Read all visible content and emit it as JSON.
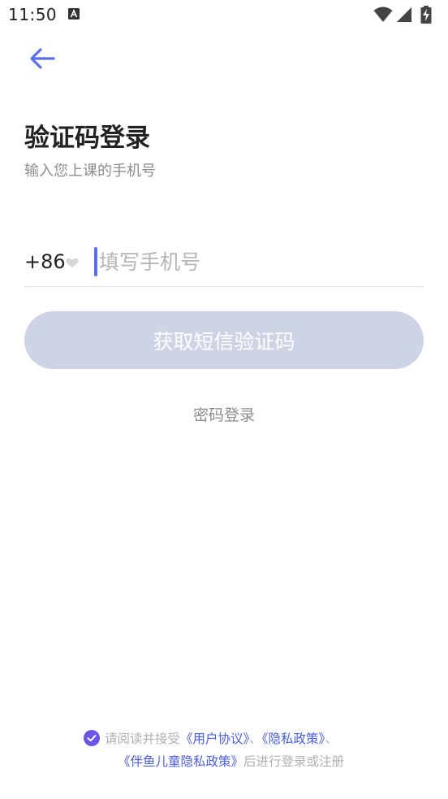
{
  "status_bar": {
    "time": "11:50",
    "notification_icon": "a-box-icon",
    "icons": [
      "wifi-icon",
      "signal-icon",
      "battery-charging-icon"
    ]
  },
  "header": {
    "back_icon": "arrow-left-icon"
  },
  "main": {
    "title": "验证码登录",
    "subtitle": "输入您上课的手机号",
    "country_code": "+86",
    "phone_placeholder": "填写手机号",
    "phone_value": "",
    "sms_button_label": "获取短信验证码",
    "password_login_label": "密码登录"
  },
  "agreement": {
    "prefix": "请阅读并接受",
    "user_agreement": "《用户协议》",
    "sep1": "、",
    "privacy_policy": "《隐私政策》",
    "sep2": "、",
    "child_privacy_policy": "《伴鱼儿童隐私政策》",
    "suffix": "后进行登录或注册"
  },
  "colors": {
    "accent": "#5b6fe8",
    "button_disabled": "#cfd3e6",
    "link": "#4a5ee0",
    "check": "#6a55e6"
  }
}
